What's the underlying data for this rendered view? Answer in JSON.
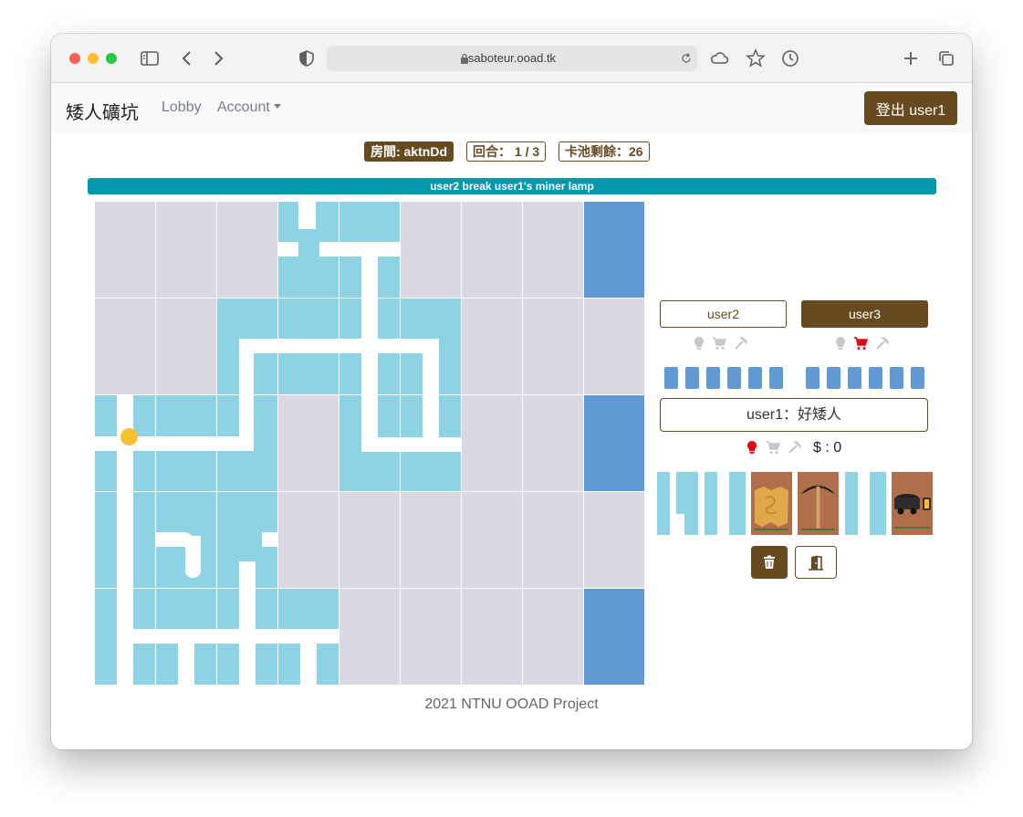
{
  "browser": {
    "url": "saboteur.ooad.tk"
  },
  "navbar": {
    "brand": "矮人礦坑",
    "lobby": "Lobby",
    "account": "Account",
    "logout": "登出 user1"
  },
  "info": {
    "room": "房間: aktnDd",
    "round": "回合： 1 / 3",
    "pool": "卡池剩餘：26"
  },
  "message": "user2 break user1's miner lamp",
  "players": [
    {
      "name": "user2",
      "lamp": "ok",
      "cart": "ok",
      "pick": "ok",
      "hand_count": 6
    },
    {
      "name": "user3",
      "lamp": "ok",
      "cart": "broken",
      "pick": "ok",
      "hand_count": 6
    }
  ],
  "self": {
    "label": "user1：好矮人",
    "lamp": "broken",
    "cart": "ok",
    "pick": "ok",
    "money": "$ : 0"
  },
  "hand_cards": [
    "tunnel-h",
    "tunnel-ii",
    "treasure-map",
    "pickaxe",
    "tunnel-ii",
    "mine-cart-lamp"
  ],
  "footer": "2021 NTNU OOAD Project",
  "colors": {
    "accent": "#664b21",
    "board_empty": "#d8d9e3",
    "board_goal": "#6199d3",
    "tunnel": "#8cd3e4",
    "message_bg": "#0098ab",
    "broken": "#e3000f"
  }
}
